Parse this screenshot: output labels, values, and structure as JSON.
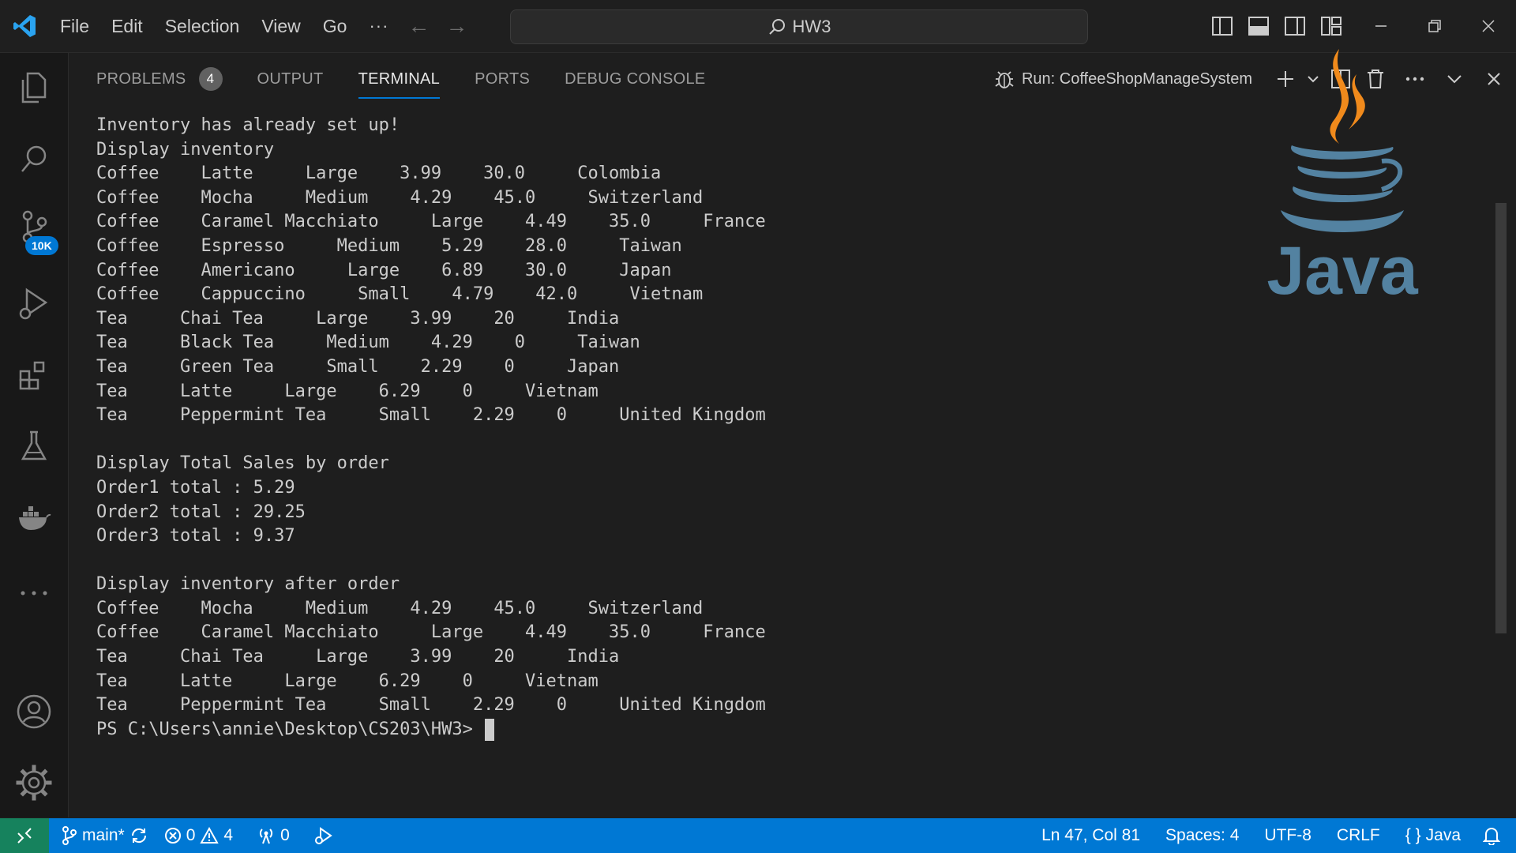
{
  "menu": {
    "items": [
      "File",
      "Edit",
      "Selection",
      "View",
      "Go"
    ],
    "more": "···"
  },
  "search": {
    "text": "HW3"
  },
  "activity": {
    "scm_badge": "10K"
  },
  "panel": {
    "tabs": [
      "PROBLEMS",
      "OUTPUT",
      "TERMINAL",
      "PORTS",
      "DEBUG CONSOLE"
    ],
    "active_tab": "TERMINAL",
    "problems_count": "4",
    "run_config": "Run: CoffeeShopManageSystem"
  },
  "terminal": {
    "lines": [
      "Inventory has already set up!",
      "Display inventory",
      "Coffee    Latte     Large    3.99    30.0     Colombia",
      "Coffee    Mocha     Medium    4.29    45.0     Switzerland",
      "Coffee    Caramel Macchiato     Large    4.49    35.0     France",
      "Coffee    Espresso     Medium    5.29    28.0     Taiwan",
      "Coffee    Americano     Large    6.89    30.0     Japan",
      "Coffee    Cappuccino     Small    4.79    42.0     Vietnam",
      "Tea     Chai Tea     Large    3.99    20     India",
      "Tea     Black Tea     Medium    4.29    0     Taiwan",
      "Tea     Green Tea     Small    2.29    0     Japan",
      "Tea     Latte     Large    6.29    0     Vietnam",
      "Tea     Peppermint Tea     Small    2.29    0     United Kingdom",
      "",
      "Display Total Sales by order",
      "Order1 total : 5.29",
      "Order2 total : 29.25",
      "Order3 total : 9.37",
      "",
      "Display inventory after order",
      "Coffee    Mocha     Medium    4.29    45.0     Switzerland",
      "Coffee    Caramel Macchiato     Large    4.49    35.0     France",
      "Tea     Chai Tea     Large    3.99    20     India",
      "Tea     Latte     Large    6.29    0     Vietnam",
      "Tea     Peppermint Tea     Small    2.29    0     United Kingdom"
    ],
    "prompt": "PS C:\\Users\\annie\\Desktop\\CS203\\HW3> "
  },
  "logo": {
    "text": "Java"
  },
  "status": {
    "branch": "main*",
    "errors": "0",
    "warnings": "4",
    "ports": "0",
    "position": "Ln 47, Col 81",
    "spaces": "Spaces: 4",
    "encoding": "UTF-8",
    "eol": "CRLF",
    "language": "Java"
  },
  "colors": {
    "accent": "#0078d4",
    "remote": "#16825d",
    "vscode_blue": "#2aa3f0"
  }
}
